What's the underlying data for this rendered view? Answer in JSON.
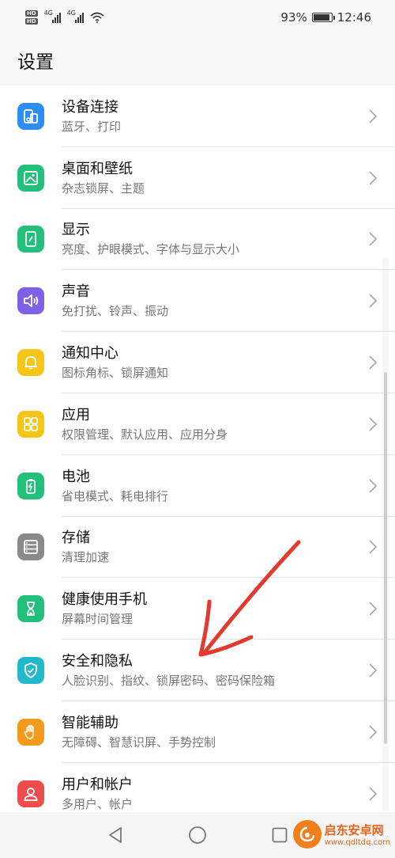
{
  "status_bar": {
    "hd_labels": [
      "HD",
      "HD"
    ],
    "signal_labels": [
      "4G",
      "4G"
    ],
    "battery_percent_text": "93%",
    "battery_level": 0.93,
    "time": "12:46"
  },
  "header": {
    "title": "设置"
  },
  "settings": [
    {
      "title": "设备连接",
      "subtitle": "蓝牙、打印",
      "icon": "device-connect-icon",
      "color": "#2d8df0"
    },
    {
      "title": "桌面和壁纸",
      "subtitle": "杂志锁屏、主题",
      "icon": "wallpaper-icon",
      "color": "#22c07b"
    },
    {
      "title": "显示",
      "subtitle": "亮度、护眼模式、字体与显示大小",
      "icon": "display-icon",
      "color": "#22c07b"
    },
    {
      "title": "声音",
      "subtitle": "免打扰、铃声、振动",
      "icon": "sound-icon",
      "color": "#7d62e6"
    },
    {
      "title": "通知中心",
      "subtitle": "图标角标、锁屏通知",
      "icon": "bell-icon",
      "color": "#f5c518"
    },
    {
      "title": "应用",
      "subtitle": "权限管理、默认应用、应用分身",
      "icon": "apps-icon",
      "color": "#f5c518"
    },
    {
      "title": "电池",
      "subtitle": "省电模式、耗电排行",
      "icon": "battery-icon",
      "color": "#22c07b"
    },
    {
      "title": "存储",
      "subtitle": "清理加速",
      "icon": "storage-icon",
      "color": "#8a8a8a"
    },
    {
      "title": "健康使用手机",
      "subtitle": "屏幕时间管理",
      "icon": "hourglass-icon",
      "color": "#22c07b"
    },
    {
      "title": "安全和隐私",
      "subtitle": "人脸识别、指纹、锁屏密码、密码保险箱",
      "icon": "shield-icon",
      "color": "#22b8c9"
    },
    {
      "title": "智能辅助",
      "subtitle": "无障碍、智慧识屏、手势控制",
      "icon": "hand-icon",
      "color": "#f39a1d"
    },
    {
      "title": "用户和帐户",
      "subtitle": "多用户、帐户",
      "icon": "user-icon",
      "color": "#ee4d4d"
    }
  ],
  "nav": {
    "back": "back-icon",
    "home": "home-icon",
    "recents": "recents-icon"
  },
  "watermark": {
    "name": "启东安卓网",
    "url": "www.qdltdq.com"
  }
}
